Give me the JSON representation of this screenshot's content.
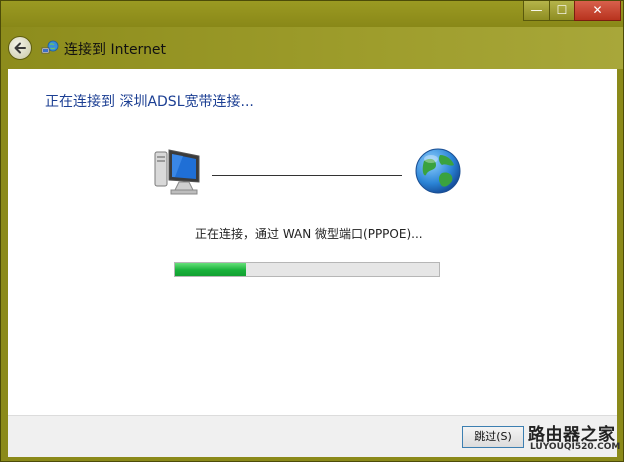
{
  "window": {
    "controls": {
      "minimize": "—",
      "maximize": "☐",
      "close": "✕"
    }
  },
  "header": {
    "title": "连接到 Internet"
  },
  "main": {
    "heading": "正在连接到 深圳ADSL宽带连接...",
    "status": "正在连接，通过 WAN 微型端口(PPPOE)...",
    "progress": 0.27
  },
  "footer": {
    "skip_label": "跳过(S)"
  },
  "watermark": {
    "cn": "路由器之家",
    "en": "LUYOUQI520.COM"
  },
  "colors": {
    "frame": "#8b8a1a",
    "heading_text": "#1c3f93",
    "progress_fill": "#19b13a",
    "close_button": "#c7412b"
  }
}
